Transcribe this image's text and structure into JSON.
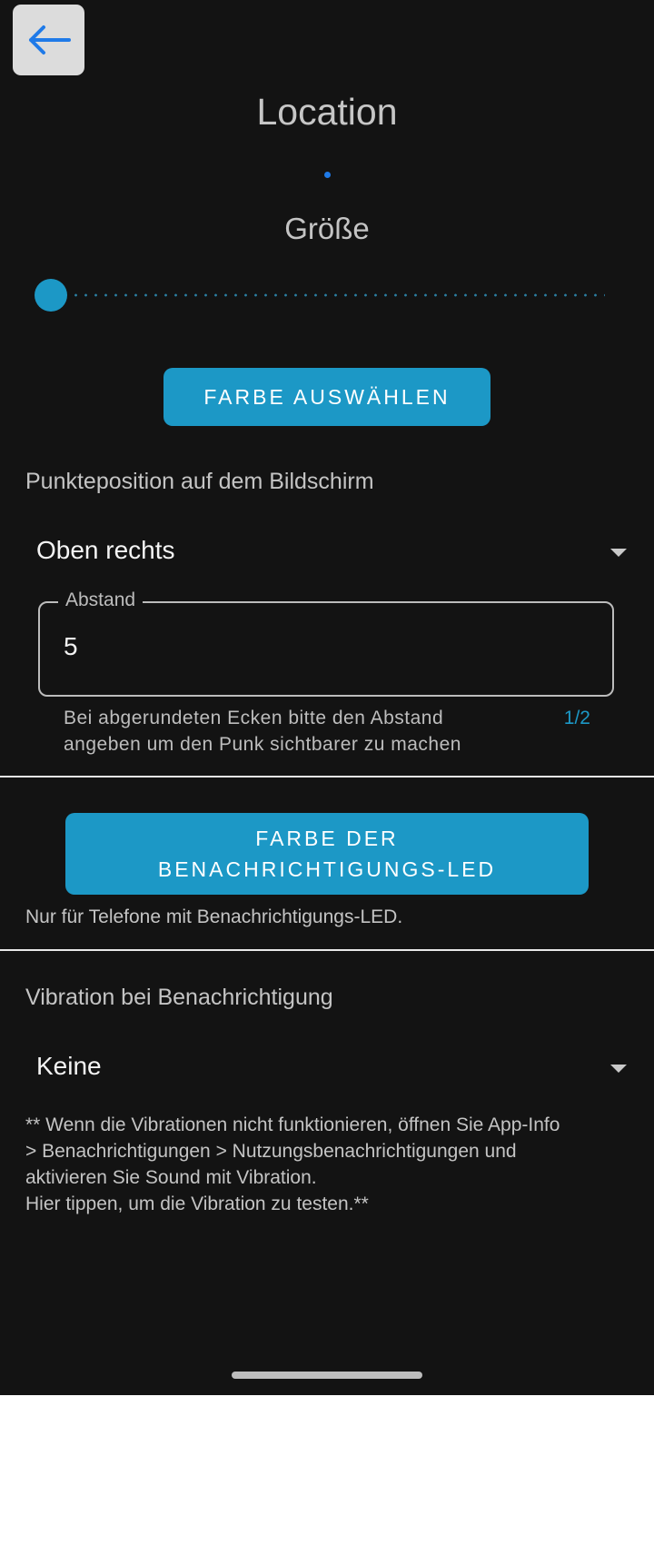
{
  "header": {
    "title": "Location",
    "back_icon": "arrow-left-icon",
    "accent": "#1f7ae8"
  },
  "dot_preview": {
    "color": "#1f7ae8"
  },
  "size": {
    "label": "Größe",
    "slider_fraction": 0
  },
  "buttons": {
    "choose_color": "FARBE AUSWÄHLEN",
    "led_color_line1": "FARBE DER",
    "led_color_line2": "BENACHRICHTIGUNGS-LED",
    "button_color": "#1c98c6"
  },
  "position": {
    "label": "Punkteposition auf dem Bildschirm",
    "selected": "Oben rechts"
  },
  "distance": {
    "legend": "Abstand",
    "value": "5",
    "helper_line1": "Bei abgerundeten Ecken bitte den Abstand",
    "helper_line2": "angeben um den Punk sichtbarer zu machen",
    "counter": "1/2"
  },
  "led": {
    "note": "Nur für Telefone mit Benachrichtigungs-LED."
  },
  "vibration": {
    "label": "Vibration bei Benachrichtigung",
    "selected": "Keine",
    "note_line1": "** Wenn die Vibrationen nicht funktionieren, öffnen Sie App-Info",
    "note_line2": "> Benachrichtigungen > Nutzungsbenachrichtigungen und",
    "note_line3": "aktivieren Sie Sound mit Vibration.",
    "note_line4": "Hier tippen, um die Vibration zu testen.**"
  }
}
